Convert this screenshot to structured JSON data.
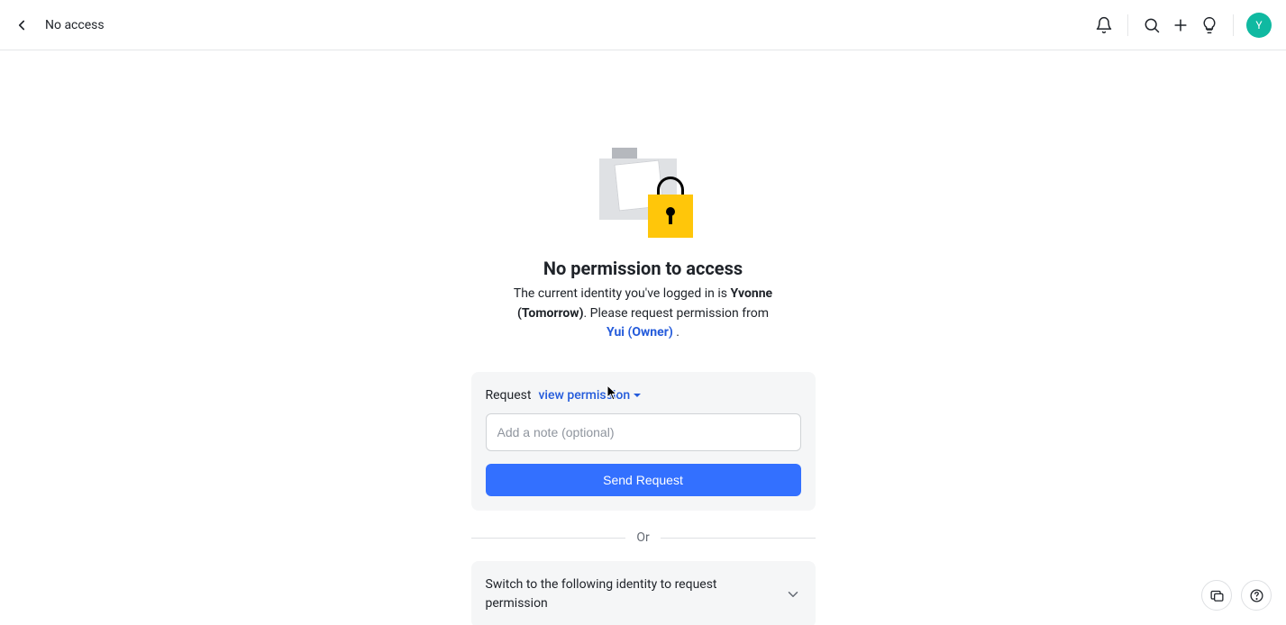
{
  "header": {
    "title": "No access",
    "avatar_initial": "Y"
  },
  "main": {
    "heading": "No permission to access",
    "sub_part1": "The current identity you've logged in is ",
    "identity": "Yvonne (Tomorrow)",
    "sub_part2": ". Please request permission from ",
    "owner": "Yui (Owner)",
    "sub_part3": " ."
  },
  "request_card": {
    "label": "Request",
    "dropdown_label": "view permission",
    "note_placeholder": "Add a note (optional)",
    "button_label": "Send Request"
  },
  "divider": {
    "or_label": "Or"
  },
  "switch_card": {
    "text": "Switch to the following identity to request permission"
  }
}
